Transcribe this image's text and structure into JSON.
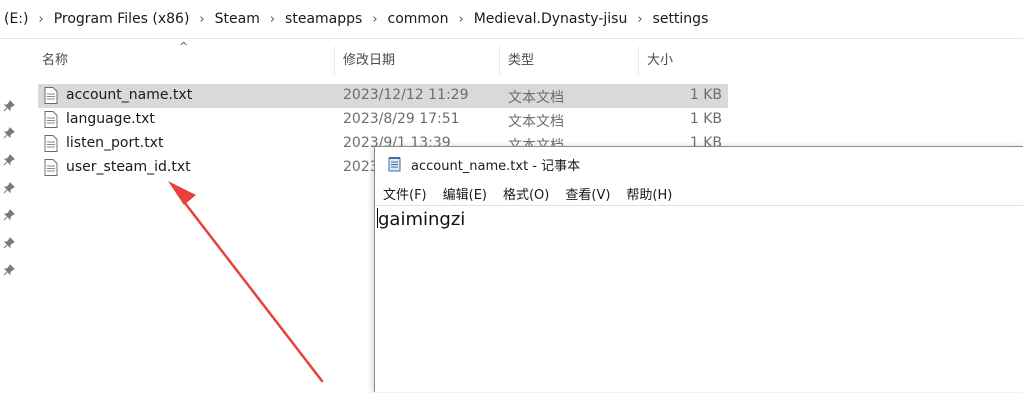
{
  "explorer": {
    "breadcrumb": [
      "(E:)",
      "Program Files (x86)",
      "Steam",
      "steamapps",
      "common",
      "Medieval.Dynasty-jisu",
      "settings"
    ],
    "columns": {
      "name": "名称",
      "date": "修改日期",
      "type": "类型",
      "size": "大小"
    },
    "files": [
      {
        "name": "account_name.txt",
        "date": "2023/12/12 11:29",
        "type": "文本文档",
        "size": "1 KB"
      },
      {
        "name": "language.txt",
        "date": "2023/8/29 17:51",
        "type": "文本文档",
        "size": "1 KB"
      },
      {
        "name": "listen_port.txt",
        "date": "2023/9/1 13:39",
        "type": "文本文档",
        "size": "1 KB"
      },
      {
        "name": "user_steam_id.txt",
        "date": "2023",
        "type": "",
        "size": ""
      }
    ]
  },
  "notepad": {
    "title": "account_name.txt - 记事本",
    "menu": [
      "文件(F)",
      "编辑(E)",
      "格式(O)",
      "查看(V)",
      "帮助(H)"
    ],
    "content": "gaimingzi"
  },
  "colors": {
    "selection": "#d9d9d9",
    "arrow": "#e8403a",
    "pin": "#7a7a7a"
  }
}
